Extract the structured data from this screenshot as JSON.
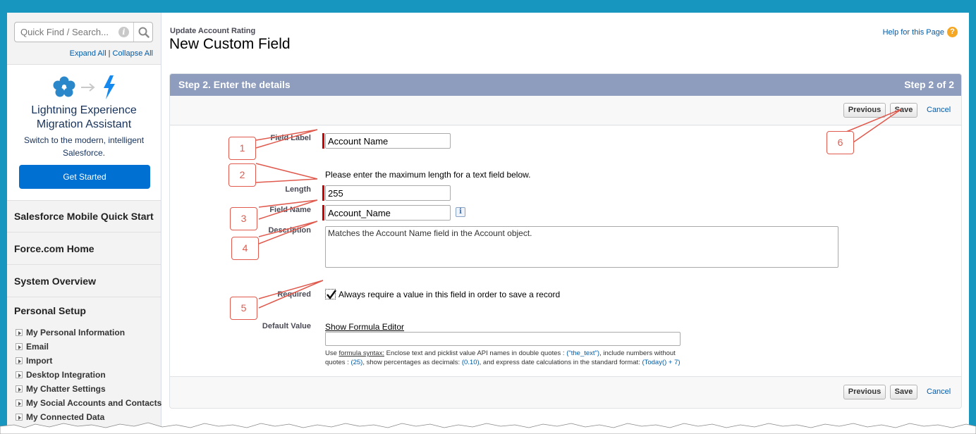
{
  "sidebar": {
    "quick_find_placeholder": "Quick Find / Search...",
    "expand_all": "Expand All",
    "collapse_all": "Collapse All",
    "lex": {
      "title": "Lightning Experience Migration Assistant",
      "subtitle": "Switch to the modern, intelligent Salesforce.",
      "button": "Get Started"
    },
    "nav": [
      {
        "label": "Salesforce Mobile Quick Start"
      },
      {
        "label": "Force.com Home"
      },
      {
        "label": "System Overview"
      },
      {
        "label": "Personal Setup"
      }
    ],
    "personal_items": [
      {
        "label": "My Personal Information"
      },
      {
        "label": "Email"
      },
      {
        "label": "Import"
      },
      {
        "label": "Desktop Integration"
      },
      {
        "label": "My Chatter Settings"
      },
      {
        "label": "My Social Accounts and Contacts"
      },
      {
        "label": "My Connected Data"
      }
    ]
  },
  "header": {
    "breadcrumb": "Update Account Rating",
    "title": "New Custom Field",
    "help": "Help for this Page"
  },
  "panel": {
    "step_title": "Step 2. Enter the details",
    "step_count": "Step 2 of 2",
    "previous": "Previous",
    "save": "Save",
    "cancel": "Cancel"
  },
  "form": {
    "field_label": {
      "label": "Field Label",
      "value": "Account Name"
    },
    "length": {
      "label": "Length",
      "note": "Please enter the maximum length for a text field below.",
      "value": "255"
    },
    "field_name": {
      "label": "Field Name",
      "value": "Account_Name",
      "info": "i"
    },
    "description": {
      "label": "Description",
      "value": "Matches the Account Name field in the Account object."
    },
    "required": {
      "label": "Required",
      "checked": true,
      "text": "Always require a value in this field in order to save a record"
    },
    "default_value": {
      "label": "Default Value",
      "link": "Show Formula Editor",
      "value": "",
      "hint": {
        "p1": "Use ",
        "syntax": "formula syntax:",
        "p2": " Enclose text and picklist value API names in double quotes : ",
        "ex1": "(\"the_text\")",
        "p3": ", include numbers without",
        "p4": "quotes : ",
        "ex2": "(25)",
        "p5": ", show percentages as decimals: ",
        "ex3": "(0.10)",
        "p6": ", and express date calculations in the standard format: ",
        "ex4": "(Today() + 7)"
      }
    }
  },
  "annotations": {
    "c1": "1",
    "c2": "2",
    "c3": "3",
    "c4": "4",
    "c5": "5",
    "c6": "6",
    "color": "#e05a4e"
  },
  "colors": {
    "frame_background": "#1797c0",
    "step_header": "#8e9dbe",
    "primary_button": "#0070d2",
    "required_bar": "#cc0000",
    "link": "#015ba7"
  }
}
